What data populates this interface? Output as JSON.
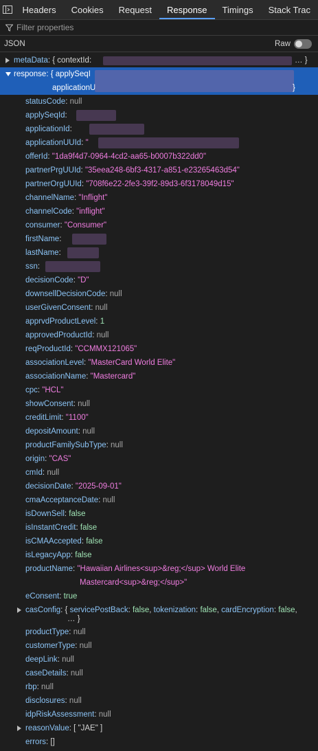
{
  "tabs": [
    {
      "label": "Headers",
      "active": false
    },
    {
      "label": "Cookies",
      "active": false
    },
    {
      "label": "Request",
      "active": false
    },
    {
      "label": "Response",
      "active": true
    },
    {
      "label": "Timings",
      "active": false
    },
    {
      "label": "Stack Trac",
      "active": false
    }
  ],
  "filter": {
    "placeholder": "Filter properties"
  },
  "viewer": {
    "mode_label": "JSON",
    "raw_label": "Raw",
    "raw_enabled": false
  },
  "tree": {
    "meta": {
      "key": "metaData",
      "preview_open": "{ contextId:",
      "preview_close": "… }"
    },
    "response": {
      "key": "response",
      "preview_line1": "{ applySeqI",
      "preview_line2": "applicationU",
      "preview_close": "}"
    },
    "fields": [
      {
        "key": "statusCode",
        "value": "null",
        "type": "null"
      },
      {
        "key": "applySeqId",
        "value": "",
        "type": "redacted"
      },
      {
        "key": "applicationId",
        "value": "",
        "type": "redacted"
      },
      {
        "key": "applicationUUId",
        "value": "\"",
        "type": "redacted"
      },
      {
        "key": "offerId",
        "value": "\"1da9f4d7-0964-4cd2-aa65-b0007b322dd0\"",
        "type": "string"
      },
      {
        "key": "partnerPrgUUId",
        "value": "\"35eea248-6bf3-4317-a851-e23265463d54\"",
        "type": "string"
      },
      {
        "key": "partnerOrgUUId",
        "value": "\"708f6e22-2fe3-39f2-89d3-6f3178049d15\"",
        "type": "string"
      },
      {
        "key": "channelName",
        "value": "\"Inflight\"",
        "type": "string"
      },
      {
        "key": "channelCode",
        "value": "\"inflight\"",
        "type": "string"
      },
      {
        "key": "consumer",
        "value": "\"Consumer\"",
        "type": "string"
      },
      {
        "key": "firstName",
        "value": "",
        "type": "redacted"
      },
      {
        "key": "lastName",
        "value": "",
        "type": "redacted"
      },
      {
        "key": "ssn",
        "value": "",
        "type": "redacted"
      },
      {
        "key": "decisionCode",
        "value": "\"D\"",
        "type": "string"
      },
      {
        "key": "downsellDecisionCode",
        "value": "null",
        "type": "null"
      },
      {
        "key": "userGivenConsent",
        "value": "null",
        "type": "null"
      },
      {
        "key": "apprvdProductLevel",
        "value": "1",
        "type": "number"
      },
      {
        "key": "approvedProductId",
        "value": "null",
        "type": "null"
      },
      {
        "key": "reqProductId",
        "value": "\"CCMMX121065\"",
        "type": "string"
      },
      {
        "key": "associationLevel",
        "value": "\"MasterCard World Elite\"",
        "type": "string"
      },
      {
        "key": "associationName",
        "value": "\"Mastercard\"",
        "type": "string"
      },
      {
        "key": "cpc",
        "value": "\"HCL\"",
        "type": "string"
      },
      {
        "key": "showConsent",
        "value": "null",
        "type": "null"
      },
      {
        "key": "creditLimit",
        "value": "\"1100\"",
        "type": "string"
      },
      {
        "key": "depositAmount",
        "value": "null",
        "type": "null"
      },
      {
        "key": "productFamilySubType",
        "value": "null",
        "type": "null"
      },
      {
        "key": "origin",
        "value": "\"CAS\"",
        "type": "string"
      },
      {
        "key": "cmId",
        "value": "null",
        "type": "null"
      },
      {
        "key": "decisionDate",
        "value": "\"2025-09-01\"",
        "type": "string"
      },
      {
        "key": "cmaAcceptanceDate",
        "value": "null",
        "type": "null"
      },
      {
        "key": "isDownSell",
        "value": "false",
        "type": "bool"
      },
      {
        "key": "isInstantCredit",
        "value": "false",
        "type": "bool"
      },
      {
        "key": "isCMAAccepted",
        "value": "false",
        "type": "bool"
      },
      {
        "key": "isLegacyApp",
        "value": "false",
        "type": "bool"
      }
    ],
    "productName": {
      "key": "productName",
      "line1": "\"Hawaiian Airlines<sup>&reg;</sup> World Elite",
      "line2": "Mastercard<sup>&reg;</sup>\""
    },
    "eConsent": {
      "key": "eConsent",
      "value": "true"
    },
    "casConfig": {
      "key": "casConfig",
      "open": "{",
      "items": [
        {
          "k": "servicePostBack",
          "v": "false"
        },
        {
          "k": "tokenization",
          "v": "false"
        },
        {
          "k": "cardEncryption",
          "v": "false"
        }
      ],
      "trailing": ",",
      "line2": "… }"
    },
    "fields2": [
      {
        "key": "productType",
        "value": "null"
      },
      {
        "key": "customerType",
        "value": "null"
      },
      {
        "key": "deepLink",
        "value": "null"
      },
      {
        "key": "caseDetails",
        "value": "null"
      },
      {
        "key": "rbp",
        "value": "null"
      },
      {
        "key": "disclosures",
        "value": "null"
      },
      {
        "key": "idpRiskAssessment",
        "value": "null"
      }
    ],
    "reasonValue": {
      "key": "reasonValue",
      "value": "[ \"JAE\" ]"
    },
    "errors": {
      "key": "errors",
      "value": "[]"
    }
  }
}
